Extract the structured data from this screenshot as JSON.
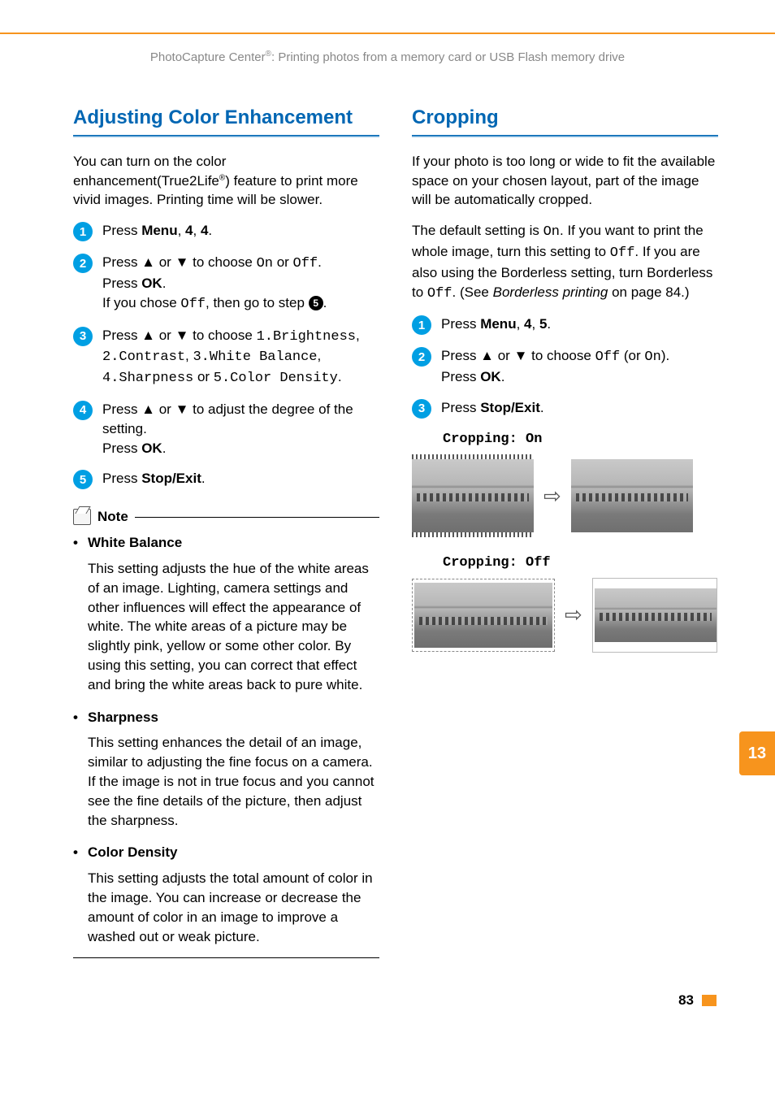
{
  "running_head": {
    "pre": "PhotoCapture Center",
    "sup": "®",
    "post": ": Printing photos from a memory card or USB Flash memory drive"
  },
  "side_tab": "13",
  "page_number": "83",
  "left": {
    "title": "Adjusting Color Enhancement",
    "intro": {
      "a": "You can turn on the color enhancement(True2Life",
      "sup": "®",
      "b": ") feature to print more vivid images. Printing time will be slower."
    },
    "steps": [
      {
        "n": "1",
        "pre": "Press ",
        "bold": "Menu",
        "mid": ", ",
        "b2": "4",
        "mid2": ", ",
        "b3": "4",
        "post": "."
      },
      {
        "n": "2",
        "l1a": "Press ▲ or ▼ to choose ",
        "l1m1": "On",
        "l1b": " or ",
        "l1m2": "Off",
        "l1c": ".",
        "l2a": "Press ",
        "l2b": "OK",
        "l2c": ".",
        "l3a": "If you chose ",
        "l3m": "Off",
        "l3b": ", then go to step ",
        "l3ref": "5",
        "l3c": "."
      },
      {
        "n": "3",
        "a": "Press ▲ or ▼ to choose ",
        "m1": "1.Brightness",
        "b": ", ",
        "m2": "2.Contrast",
        "c": ", ",
        "m3": "3.White Balance",
        "d": ", ",
        "m4": "4.Sharpness",
        "e": " or ",
        "m5": "5.Color Density",
        "f": "."
      },
      {
        "n": "4",
        "a": "Press ▲ or ▼ to adjust the degree of the setting.",
        "b": "Press ",
        "bold": "OK",
        "c": "."
      },
      {
        "n": "5",
        "a": "Press ",
        "bold": "Stop/Exit",
        "b": "."
      }
    ],
    "note_title": "Note",
    "notes": [
      {
        "label": "White Balance",
        "body": "This setting adjusts the hue of the white areas of an image. Lighting, camera settings and other influences will effect the appearance of white. The white areas of a picture may be slightly pink, yellow or some other color. By using this setting, you can correct that effect and bring the white areas back to pure white."
      },
      {
        "label": "Sharpness",
        "body": "This setting enhances the detail of an image, similar to adjusting the fine focus on a camera. If the image is not in true focus and you cannot see the fine details of the picture, then adjust the sharpness."
      },
      {
        "label": "Color Density",
        "body": "This setting adjusts the total amount of color in the image. You can increase or decrease the amount of color in an image to improve a washed out or weak picture."
      }
    ]
  },
  "right": {
    "title": "Cropping",
    "p1": "If your photo is too long or wide to fit the available space on your chosen layout, part of the image will be automatically cropped.",
    "p2": {
      "a": "The default setting is ",
      "m1": "On",
      "b": ". If you want to print the whole image, turn this setting to ",
      "m2": "Off",
      "c": ". If you are also using the Borderless setting, turn Borderless to ",
      "m3": "Off",
      "d": ". (See ",
      "i": "Borderless printing",
      "e": " on page 84.)"
    },
    "steps": [
      {
        "n": "1",
        "pre": "Press ",
        "bold": "Menu",
        "mid": ", ",
        "b2": "4",
        "mid2": ", ",
        "b3": "5",
        "post": "."
      },
      {
        "n": "2",
        "a": "Press ▲ or ▼ to choose ",
        "m1": "Off",
        "b": " (or ",
        "m2": "On",
        "c": ").",
        "d": "Press ",
        "bold": "OK",
        "e": "."
      },
      {
        "n": "3",
        "a": "Press ",
        "bold": "Stop/Exit",
        "b": "."
      }
    ],
    "fig_on": "Cropping: On",
    "fig_off": "Cropping: Off"
  }
}
